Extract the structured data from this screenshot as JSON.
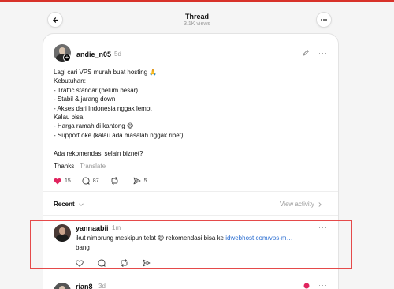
{
  "header": {
    "title": "Thread",
    "views": "3.1K views"
  },
  "post": {
    "username": "andie_n05",
    "time": "5d",
    "text": "Lagi cari VPS murah buat hosting 🙏\nKebutuhan:\n- Traffic standar (belum besar)\n- Stabil & jarang down\n- Akses dari Indonesia nggak lemot\nKalau bisa:\n- Harga ramah di kantong 😅\n- Support oke (kalau ada masalah nggak ribet)\n\nAda rekomendasi selain biznet?",
    "thanks": "Thanks",
    "translate": "Translate",
    "likes": "15",
    "comments": "87",
    "shares": "5"
  },
  "sort": {
    "label": "Recent",
    "view_activity": "View activity"
  },
  "reply": {
    "username": "yannaabii",
    "time": "1m",
    "text_before": "ikut nimbrung meskipun telat 😄 rekomendasi bisa ke ",
    "link": "idwebhost.com/vps-m…",
    "text_after": "bang"
  },
  "next_reply": {
    "username": "rian8",
    "time": "3d"
  },
  "colors": {
    "top_bar": "#d8322a",
    "like_red": "#e0245e",
    "link_blue": "#2b6ed1",
    "highlight_border": "#e54a4a"
  }
}
